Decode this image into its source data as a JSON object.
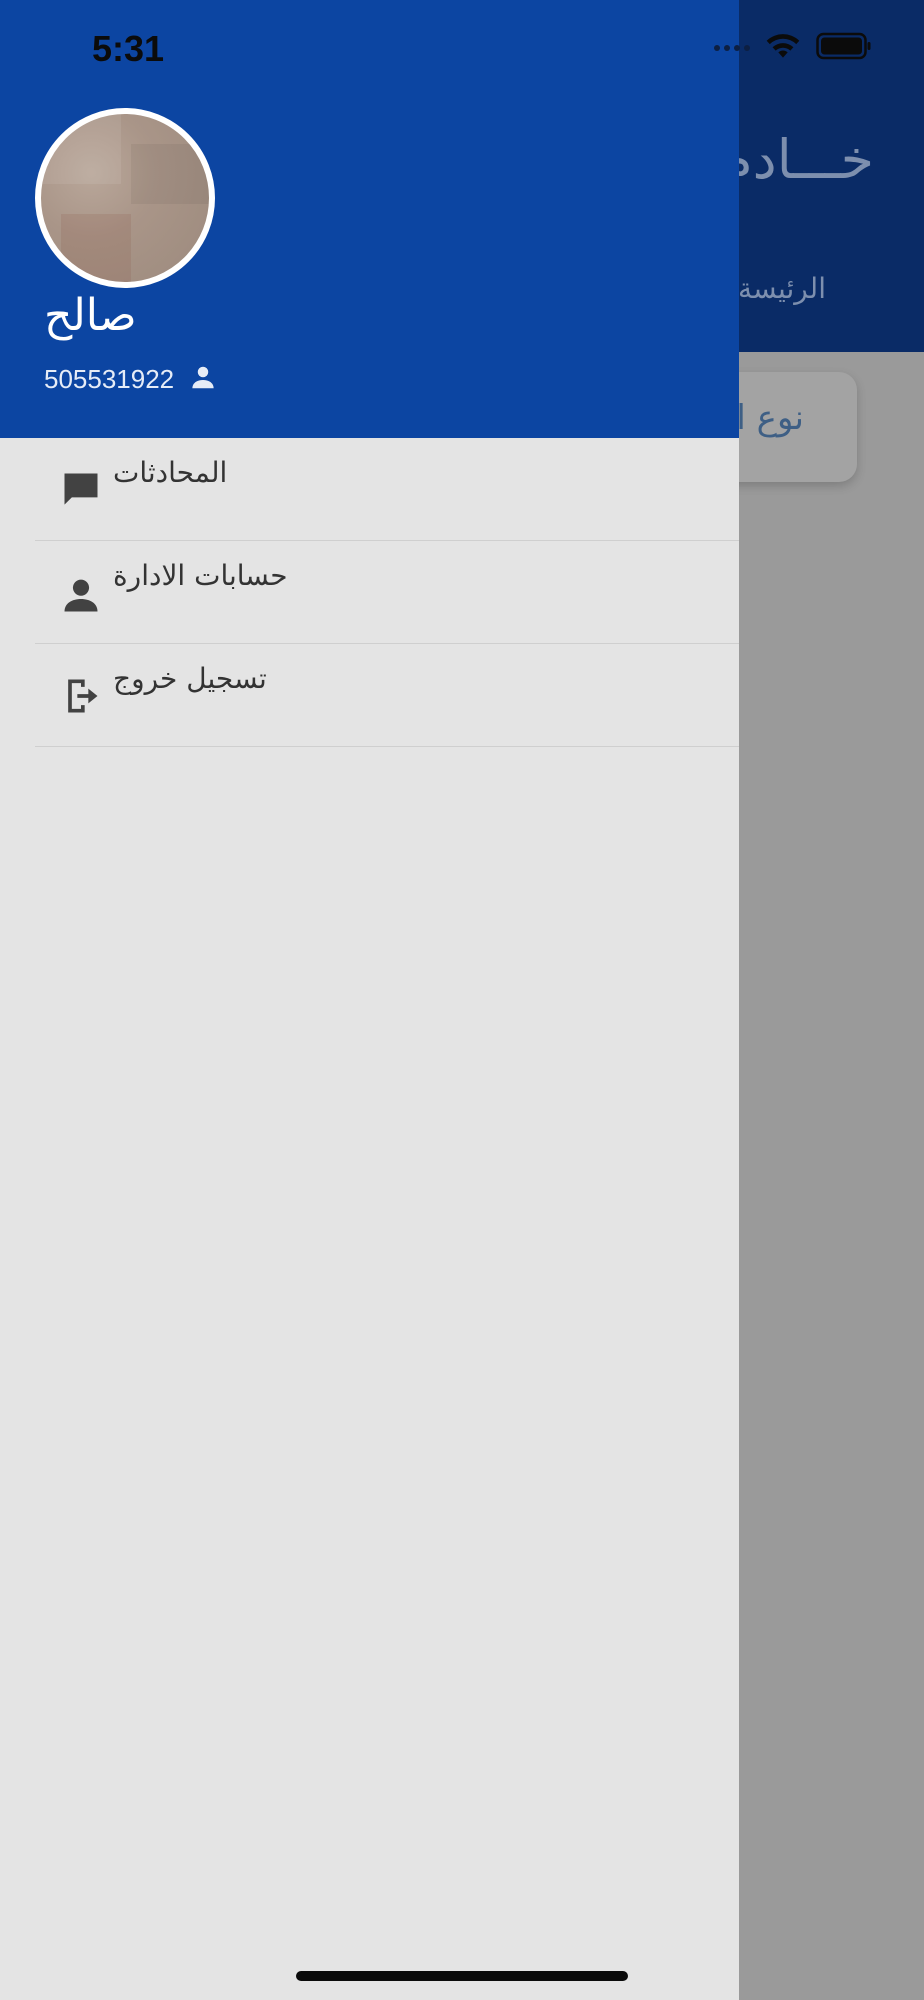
{
  "status_bar": {
    "time": "5:31"
  },
  "background_app": {
    "title": "خـــادم",
    "tab": "الرئيسة",
    "card_text": "نوع ا"
  },
  "drawer": {
    "user": {
      "name": "صالح",
      "phone": "505531922"
    },
    "menu": [
      {
        "label": "المحادثات",
        "icon": "chat-icon"
      },
      {
        "label": "حسابات الادارة",
        "icon": "person-icon"
      },
      {
        "label": "تسجيل خروج",
        "icon": "logout-icon"
      }
    ]
  },
  "colors": {
    "header_blue": "#0c45a2",
    "drawer_bg": "#e4e4e4",
    "scrim": "#9a9a9a"
  }
}
